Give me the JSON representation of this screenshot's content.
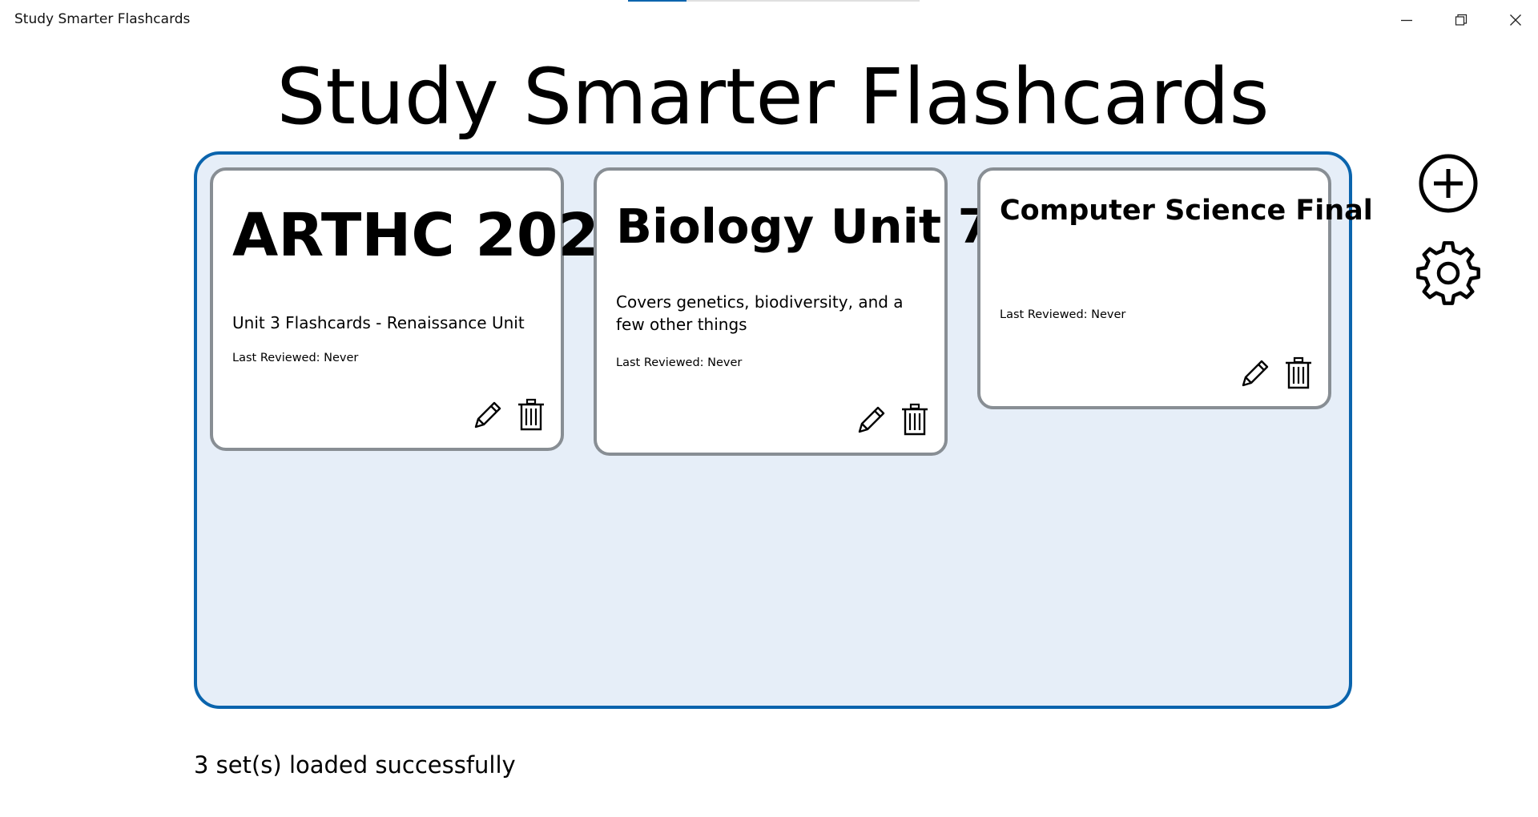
{
  "window": {
    "title": "Study Smarter Flashcards",
    "loading_progress": 0.2,
    "controls": [
      "minimize-icon",
      "restore-icon",
      "close-icon"
    ]
  },
  "header": {
    "title": "Study Smarter Flashcards"
  },
  "sets": [
    {
      "title": "ARTHC 202",
      "description": "Unit 3 Flashcards - Renaissance Unit",
      "last_reviewed": "Last Reviewed: Never",
      "edit_icon": "pencil-icon",
      "delete_icon": "trash-icon"
    },
    {
      "title": "Biology Unit 7",
      "description": "Covers genetics, biodiversity, and a few other things",
      "last_reviewed": "Last Reviewed: Never",
      "edit_icon": "pencil-icon",
      "delete_icon": "trash-icon"
    },
    {
      "title": "Computer Science Final",
      "description": "",
      "last_reviewed": "Last Reviewed: Never",
      "edit_icon": "pencil-icon",
      "delete_icon": "trash-icon"
    }
  ],
  "side_actions": {
    "add_icon": "add-circle-icon",
    "settings_icon": "gear-icon"
  },
  "status": {
    "text": "3 set(s) loaded successfully"
  },
  "colors": {
    "accent": "#0a64ad",
    "panel_bg": "#e6eef8",
    "card_border": "#888e94"
  }
}
